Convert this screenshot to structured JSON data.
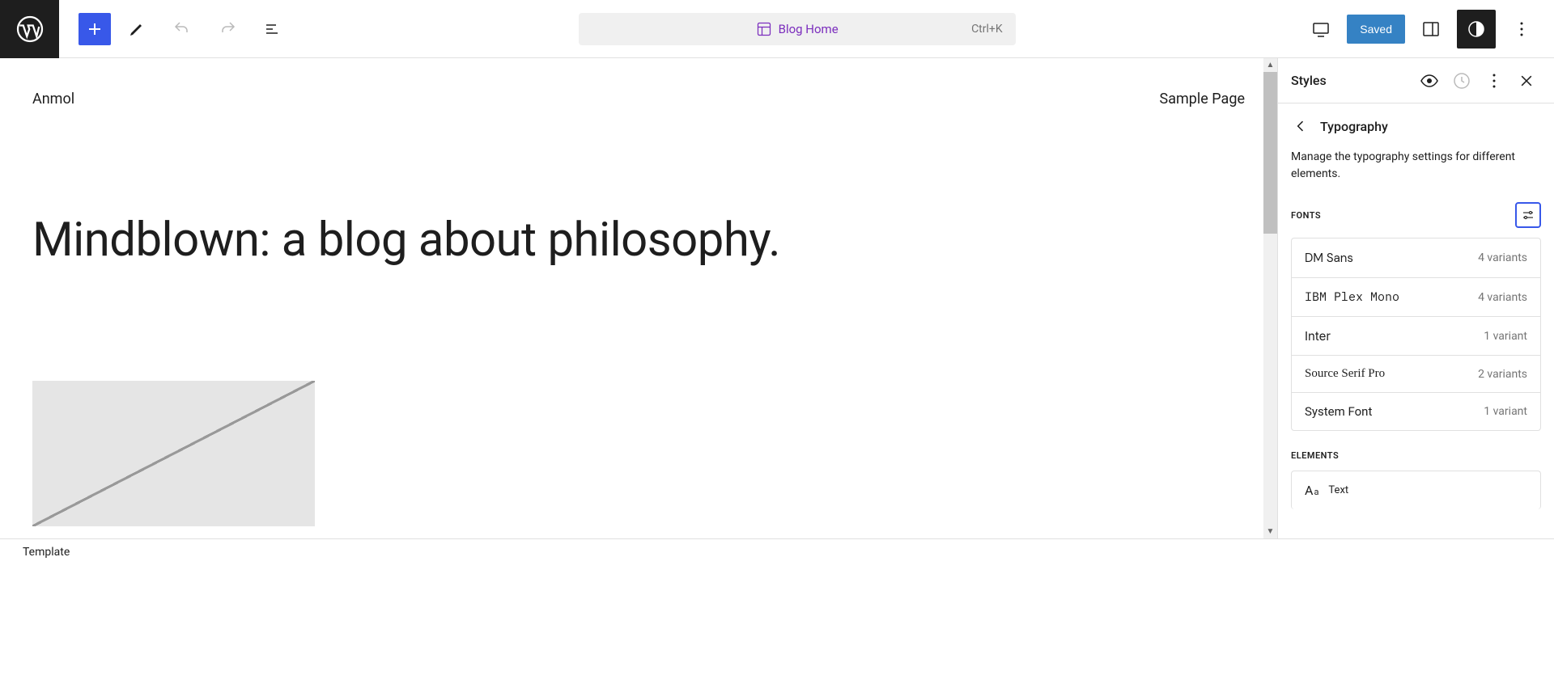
{
  "toolbar": {
    "doc_title": "Blog Home",
    "shortcut": "Ctrl+K",
    "saved_label": "Saved"
  },
  "canvas": {
    "site_title": "Anmol",
    "nav_item": "Sample Page",
    "heading": "Mindblown: a blog about philosophy."
  },
  "sidebar": {
    "title": "Styles",
    "nav_title": "Typography",
    "description": "Manage the typography settings for different elements.",
    "fonts_label": "FONTS",
    "fonts": [
      {
        "name": "DM Sans",
        "variants": "4 variants",
        "class": "f-dmsans"
      },
      {
        "name": "IBM Plex Mono",
        "variants": "4 variants",
        "class": "f-plex"
      },
      {
        "name": "Inter",
        "variants": "1 variant",
        "class": "f-inter"
      },
      {
        "name": "Source Serif Pro",
        "variants": "2 variants",
        "class": "f-serif"
      },
      {
        "name": "System Font",
        "variants": "1 variant",
        "class": ""
      }
    ],
    "elements_label": "ELEMENTS",
    "elements": [
      {
        "label": "Text"
      }
    ]
  },
  "footer": {
    "breadcrumb": "Template"
  }
}
